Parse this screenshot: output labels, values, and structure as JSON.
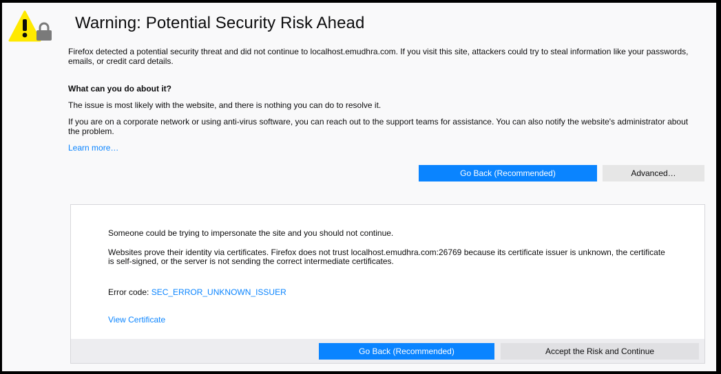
{
  "page": {
    "title": "Warning: Potential Security Risk Ahead",
    "intro": "Firefox detected a potential security threat and did not continue to localhost.emudhra.com. If you visit this site, attackers could try to steal information like your passwords, emails, or credit card details.",
    "what_heading": "What can you do about it?",
    "issue_text": "The issue is most likely with the website, and there is nothing you can do to resolve it.",
    "corporate_text": "If you are on a corporate network or using anti-virus software, you can reach out to the support teams for assistance. You can also notify the website's administrator about the problem.",
    "learn_more": "Learn more…",
    "go_back_label": "Go Back (Recommended)",
    "advanced_label": "Advanced…"
  },
  "advanced_panel": {
    "impersonate_text": "Someone could be trying to impersonate the site and you should not continue.",
    "certificates_text": "Websites prove their identity via certificates. Firefox does not trust localhost.emudhra.com:26769 because its certificate issuer is unknown, the certificate is self-signed, or the server is not sending the correct intermediate certificates.",
    "error_code_prefix": "Error code: ",
    "error_code": "SEC_ERROR_UNKNOWN_ISSUER",
    "view_certificate": "View Certificate",
    "go_back_label": "Go Back (Recommended)",
    "accept_label": "Accept the Risk and Continue"
  },
  "icons": {
    "warning": "warning-lock-icon"
  },
  "colors": {
    "accent": "#0a84ff",
    "warning_yellow": "#ffe900",
    "background": "#f9f9fa"
  }
}
